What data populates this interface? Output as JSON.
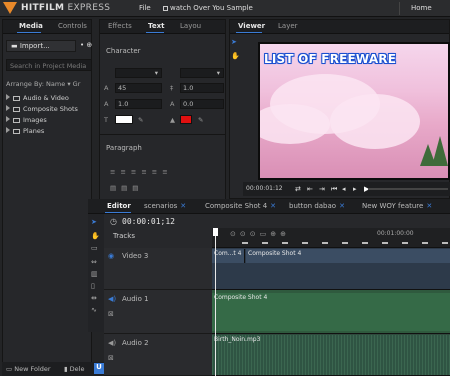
{
  "app": {
    "brand_main": "HITFILM",
    "brand_sub": "EXPRESS",
    "menu_file": "File",
    "project_name": "watch Over You Sample",
    "menu_home": "Home"
  },
  "media_panel": {
    "tabs": [
      "Media",
      "Controls"
    ],
    "import_label": "Import...",
    "search_placeholder": "Search in Project Media",
    "arrange_label": "Arrange By: Name",
    "group_label": "Gr",
    "folders": [
      "Audio & Video",
      "Composite Shots",
      "Images",
      "Planes"
    ],
    "new_folder_label": "New Folder",
    "delete_label": "Dele"
  },
  "text_panel": {
    "tabs": [
      "Effects",
      "Text",
      "Layou"
    ],
    "character_title": "Character",
    "paragraph_title": "Paragraph",
    "font_size": "45",
    "tracking": "0",
    "leading": "1.0",
    "kerning": "1.0",
    "baseline": "0.0",
    "fill_color": "#ffffff",
    "stroke_color": "#e01010"
  },
  "viewer": {
    "tabs": [
      "Viewer",
      "Layer"
    ],
    "overlay_text": "LIST OF FREEWARE",
    "timecode": "00:00:01:12"
  },
  "editor": {
    "tabs": [
      "Editor",
      "scenarios",
      "Composite Shot 4",
      "button dabao",
      "New WOY feature"
    ],
    "timecode": "00:00:01;12",
    "tracks_label": "Tracks",
    "ruler_label": "00:01:00:00",
    "tracks": [
      {
        "name": "Video 3",
        "clips": [
          "Com...t 4",
          "Composite Shot 4"
        ]
      },
      {
        "name": "Audio 1",
        "clips": [
          "Composite Shot 4"
        ]
      },
      {
        "name": "Audio 2",
        "clips": [
          "Birth_Noin.mp3"
        ]
      }
    ]
  }
}
